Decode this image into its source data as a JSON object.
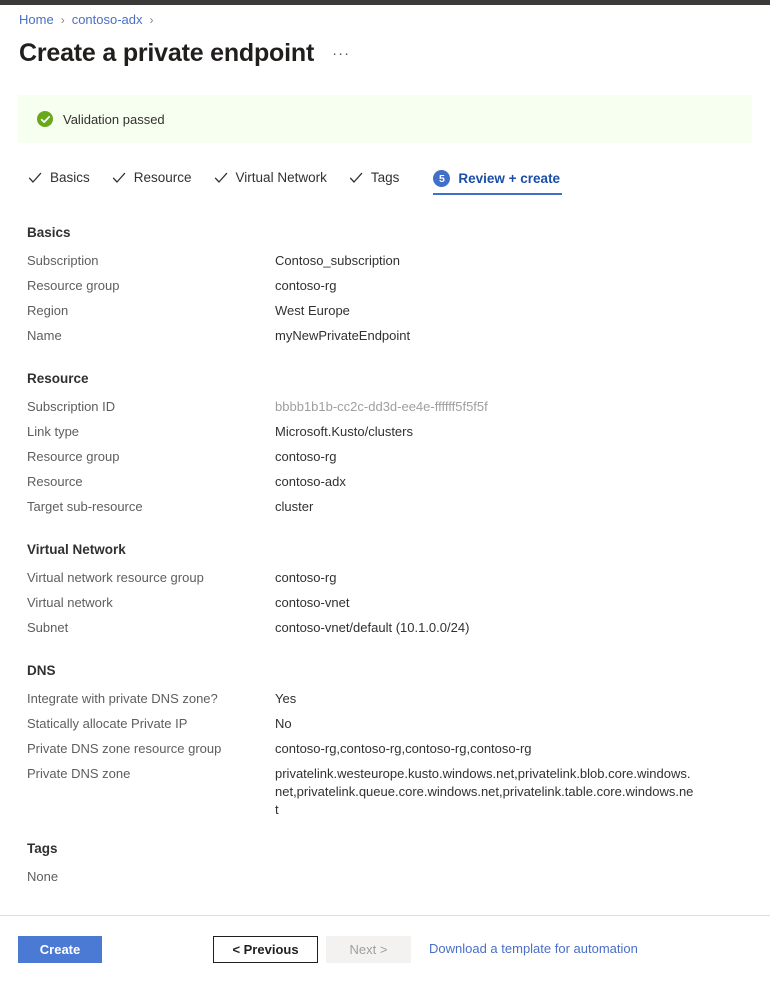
{
  "breadcrumb": {
    "items": [
      {
        "label": "Home"
      },
      {
        "label": "contoso-adx"
      }
    ],
    "separator": "›"
  },
  "header": {
    "title": "Create a private endpoint",
    "more_label": "···"
  },
  "validation": {
    "text": "Validation passed",
    "icon": "check-circle-icon",
    "background": "#f7fff0",
    "icon_color": "#6aa81b"
  },
  "tabs": [
    {
      "label": "Basics",
      "state": "complete",
      "icon": "checkmark-icon"
    },
    {
      "label": "Resource",
      "state": "complete",
      "icon": "checkmark-icon"
    },
    {
      "label": "Virtual Network",
      "state": "complete",
      "icon": "checkmark-icon"
    },
    {
      "label": "Tags",
      "state": "complete",
      "icon": "checkmark-icon"
    },
    {
      "label": "Review + create",
      "state": "active",
      "step": "5"
    }
  ],
  "accent_color": "#4170c8",
  "sections": [
    {
      "heading": "Basics",
      "rows": [
        {
          "label": "Subscription",
          "value": "Contoso_subscription"
        },
        {
          "label": "Resource group",
          "value": "contoso-rg"
        },
        {
          "label": "Region",
          "value": "West Europe"
        },
        {
          "label": "Name",
          "value": "myNewPrivateEndpoint"
        }
      ]
    },
    {
      "heading": "Resource",
      "rows": [
        {
          "label": "Subscription ID",
          "value": "bbbb1b1b-cc2c-dd3d-ee4e-ffffff5f5f5f",
          "muted": true
        },
        {
          "label": "Link type",
          "value": "Microsoft.Kusto/clusters"
        },
        {
          "label": "Resource group",
          "value": "contoso-rg"
        },
        {
          "label": "Resource",
          "value": "contoso-adx"
        },
        {
          "label": "Target sub-resource",
          "value": "cluster"
        }
      ]
    },
    {
      "heading": "Virtual Network",
      "rows": [
        {
          "label": "Virtual network resource group",
          "value": "contoso-rg"
        },
        {
          "label": "Virtual network",
          "value": "contoso-vnet"
        },
        {
          "label": "Subnet",
          "value": "contoso-vnet/default (10.1.0.0/24)"
        }
      ]
    },
    {
      "heading": "DNS",
      "rows": [
        {
          "label": "Integrate with private DNS zone?",
          "value": "Yes"
        },
        {
          "label": "Statically allocate Private IP",
          "value": "No"
        },
        {
          "label": "Private DNS zone resource group",
          "value": "contoso-rg,contoso-rg,contoso-rg,contoso-rg"
        },
        {
          "label": "Private DNS zone",
          "value": "privatelink.westeurope.kusto.windows.net,privatelink.blob.core.windows.net,privatelink.queue.core.windows.net,privatelink.table.core.windows.net"
        }
      ]
    },
    {
      "heading": "Tags",
      "empty_text": "None"
    }
  ],
  "footer": {
    "create_label": "Create",
    "previous_label": "< Previous",
    "next_label": "Next >",
    "download_template_label": "Download a template for automation"
  }
}
